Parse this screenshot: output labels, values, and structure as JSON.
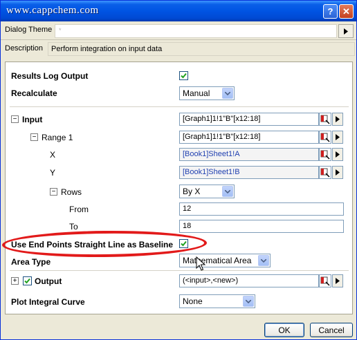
{
  "window": {
    "title": "www.cappchem.com",
    "help_glyph": "?",
    "close_glyph": "✕"
  },
  "theme": {
    "label": "Dialog Theme",
    "value": "*"
  },
  "description": {
    "label": "Description",
    "text": "Perform integration on input data"
  },
  "options": {
    "results_log_output": {
      "label": "Results Log Output",
      "checked": true
    },
    "recalculate": {
      "label": "Recalculate",
      "value": "Manual"
    },
    "input": {
      "label": "Input",
      "expander": "−",
      "value": "[Graph1]1!1\"B\"[x12:18]",
      "range1": {
        "label": "Range 1",
        "expander": "−",
        "value": "[Graph1]1!1\"B\"[x12:18]",
        "x": {
          "label": "X",
          "value": "[Book1]Sheet1!A"
        },
        "y": {
          "label": "Y",
          "value": "[Book1]Sheet1!B"
        },
        "rows": {
          "label": "Rows",
          "expander": "−",
          "value": "By X",
          "from": {
            "label": "From",
            "value": "12"
          },
          "to": {
            "label": "To",
            "value": "18"
          }
        }
      }
    },
    "baseline": {
      "label": "Use End Points Straight Line as Baseline",
      "checked": true
    },
    "area_type": {
      "label": "Area Type",
      "value": "Mathematical Area"
    },
    "output": {
      "label": "Output",
      "expander": "+",
      "checked": true,
      "value": "(<input>,<new>)"
    },
    "plot_integral_curve": {
      "label": "Plot Integral Curve",
      "value": "None"
    }
  },
  "buttons": {
    "ok": "OK",
    "cancel": "Cancel"
  },
  "colors": {
    "titlebar": "#0054e3",
    "highlight": "#e21a1a",
    "checkmark": "#21a121"
  }
}
